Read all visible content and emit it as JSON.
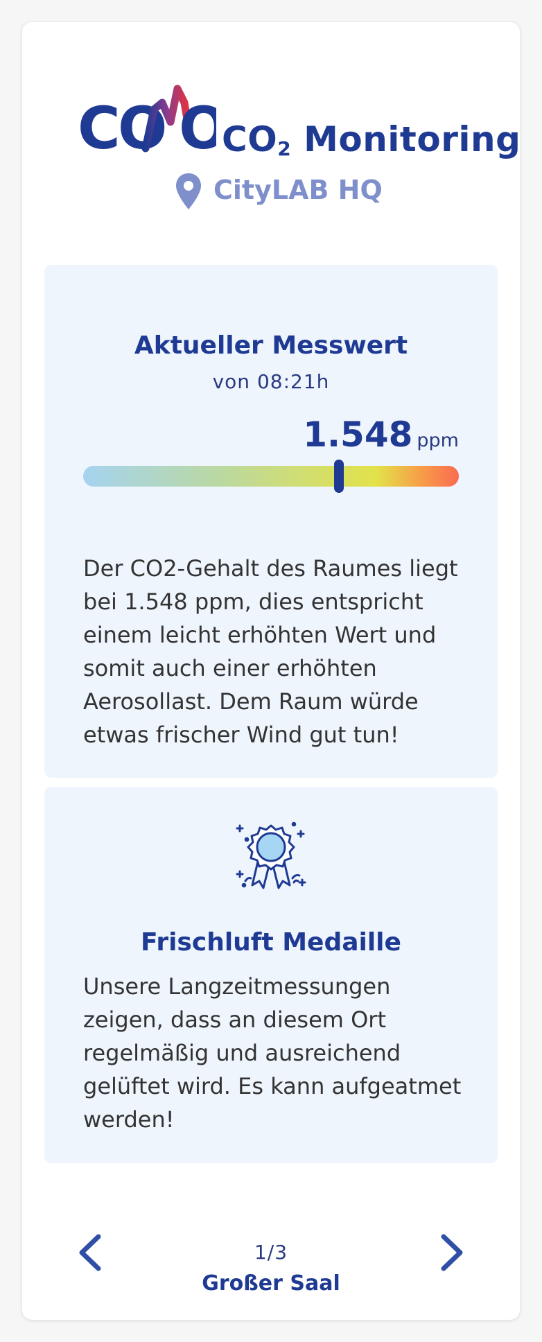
{
  "header": {
    "logo_text": "COMO",
    "title_prefix": "CO",
    "title_subscript": "2",
    "title_suffix": " Monitoring",
    "location": "CityLAB HQ"
  },
  "measurement": {
    "heading": "Aktueller Messwert",
    "timestamp": "von 08:21h",
    "value": "1.548",
    "unit": "ppm",
    "gauge_level": 0.68,
    "description": "Der CO2-Gehalt des Raumes liegt bei 1.548 ppm, dies entspricht einem leicht erhöhten Wert und somit auch einer erhöhten Aerosollast. Dem Raum würde etwas frischer Wind gut tun!"
  },
  "medal": {
    "heading": "Frischluft Medaille",
    "description": "Unsere Langzeitmessungen zeigen, dass an diesem Ort regelmäßig und ausreichend gelüftet wird. Es kann aufgeatmet werden!"
  },
  "navigation": {
    "page_indicator": "1/3",
    "room_name": "Großer Saal"
  },
  "colors": {
    "brand_blue": "#1f3a93",
    "accent_red": "#e5343d",
    "location_gray": "#7f8fcb",
    "panel_bg": "#eef5fd"
  },
  "icons": {
    "location": "map-pin-icon",
    "medal": "medal-icon",
    "prev": "chevron-left-icon",
    "next": "chevron-right-icon"
  }
}
